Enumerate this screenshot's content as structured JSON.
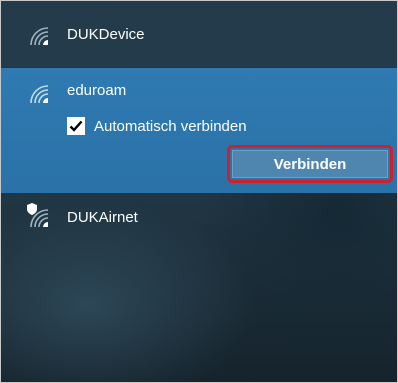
{
  "networks": [
    {
      "name": "DUKDevice",
      "icon": "wifi-icon",
      "secured": false
    },
    {
      "name": "eduroam",
      "icon": "wifi-icon",
      "selected": true,
      "auto_connect_label": "Automatisch verbinden",
      "auto_connect_checked": true,
      "connect_label": "Verbinden"
    },
    {
      "name": "DUKAirnet",
      "icon": "wifi-shield-icon",
      "secured": true
    }
  ],
  "colors": {
    "selected_row": "#2f7ab2",
    "connect_button": "#4f86b0",
    "highlight_border": "#d0202a"
  }
}
